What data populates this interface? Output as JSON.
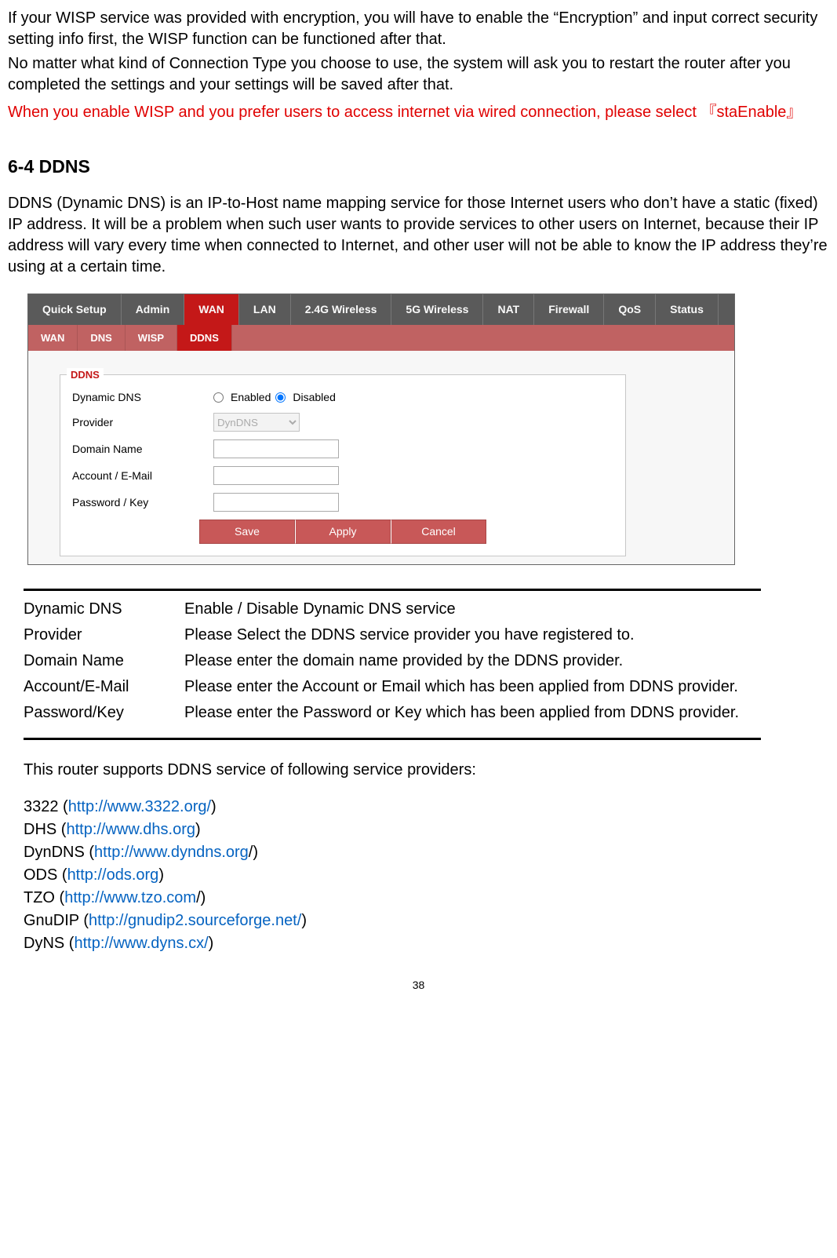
{
  "intro": {
    "p1": "If your WISP service was provided with encryption, you will have to enable the “Encryption” and input correct security setting info first, the WISP function can be functioned after that.",
    "p2": "No matter what kind of Connection Type you choose to use, the system will ask you to restart the router after you completed the settings and your settings will be saved after that.",
    "red": "When you enable WISP and you prefer users to access internet via wired connection, please select 『staEnable』"
  },
  "heading": "6-4 DDNS",
  "ddns_desc": "DDNS (Dynamic DNS) is an IP-to-Host name mapping service for those Internet users who don’t have a static (fixed) IP address. It will be a problem when such user wants to provide services to other users on Internet, because their IP address will vary every time when connected to Internet, and other user will not be able to know the IP address they’re using at a certain time.",
  "ui": {
    "main_tabs": [
      "Quick Setup",
      "Admin",
      "WAN",
      "LAN",
      "2.4G Wireless",
      "5G Wireless",
      "NAT",
      "Firewall",
      "QoS",
      "Status"
    ],
    "main_active": "WAN",
    "sub_tabs": [
      "WAN",
      "DNS",
      "WISP",
      "DDNS"
    ],
    "sub_active": "DDNS",
    "legend": "DDNS",
    "fields": {
      "dyndns_label": "Dynamic DNS",
      "enabled": "Enabled",
      "disabled": "Disabled",
      "provider_label": "Provider",
      "provider_value": "DynDNS",
      "domain_label": "Domain Name",
      "account_label": "Account / E-Mail",
      "password_label": "Password / Key"
    },
    "buttons": {
      "save": "Save",
      "apply": "Apply",
      "cancel": "Cancel"
    }
  },
  "definitions": [
    {
      "term": "Dynamic DNS",
      "desc": "Enable / Disable Dynamic DNS service"
    },
    {
      "term": "Provider",
      "desc": "Please Select the DDNS service provider you have registered to."
    },
    {
      "term": "Domain Name",
      "desc": "Please enter the domain name provided by the DDNS provider."
    },
    {
      "term": "Account/E-Mail",
      "desc": "Please enter the Account or Email which has been applied from DDNS provider."
    },
    {
      "term": "Password/Key",
      "desc": "Please enter the Password or Key which has been applied from DDNS provider."
    }
  ],
  "providers_intro": "This router supports DDNS service of following service providers:",
  "providers": [
    {
      "name": "3322",
      "url": "http://www.3322.org/",
      "suffix": ""
    },
    {
      "name": "DHS",
      "url": "http://www.dhs.org",
      "suffix": ""
    },
    {
      "name": "DynDNS",
      "url": "http://www.dyndns.org",
      "suffix": "/"
    },
    {
      "name": "ODS",
      "url": "http://ods.org",
      "suffix": ""
    },
    {
      "name": "TZO",
      "url": "http://www.tzo.com",
      "suffix": "/"
    },
    {
      "name": "GnuDIP",
      "url": "http://gnudip2.sourceforge.net/",
      "suffix": ""
    },
    {
      "name": "DyNS",
      "url": "http://www.dyns.cx/",
      "suffix": ""
    }
  ],
  "page_num": "38"
}
